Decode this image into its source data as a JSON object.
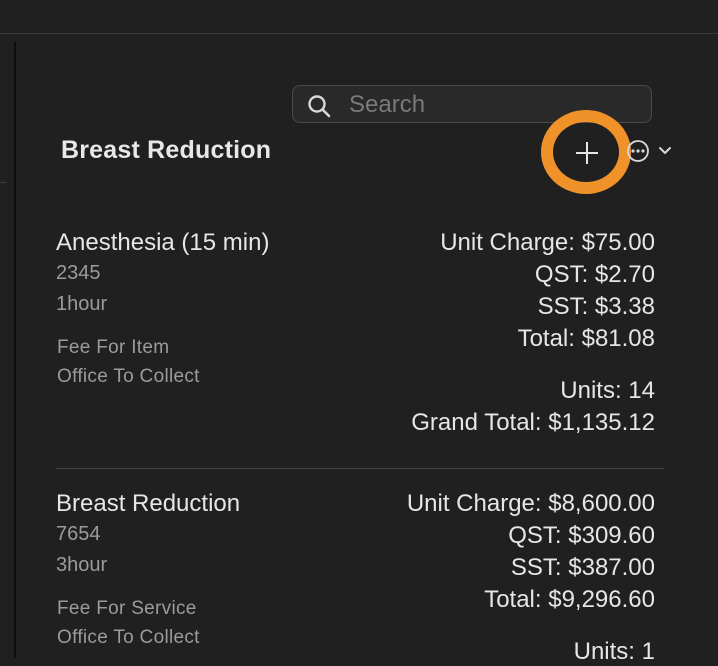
{
  "search": {
    "placeholder": "Search",
    "value": ""
  },
  "section": {
    "title": "Breast Reduction",
    "add_icon": "plus-icon",
    "more_icon": "ellipsis-circle-icon"
  },
  "accent": "#f0922a",
  "items": [
    {
      "name": "Anesthesia (15 min)",
      "code": "2345",
      "duration": "1hour",
      "fee_type": "Fee For Item",
      "collector": "Office To Collect",
      "unit_charge": "Unit Charge: $75.00",
      "qst": "QST: $2.70",
      "sst": "SST: $3.38",
      "total": "Total: $81.08",
      "units": "Units: 14",
      "grand_total": "Grand Total: $1,135.12"
    },
    {
      "name": "Breast Reduction",
      "code": "7654",
      "duration": "3hour",
      "fee_type": "Fee For Service",
      "collector": "Office To Collect",
      "unit_charge": "Unit Charge: $8,600.00",
      "qst": "QST: $309.60",
      "sst": "SST: $387.00",
      "total": "Total: $9,296.60",
      "units": "Units: 1"
    }
  ]
}
